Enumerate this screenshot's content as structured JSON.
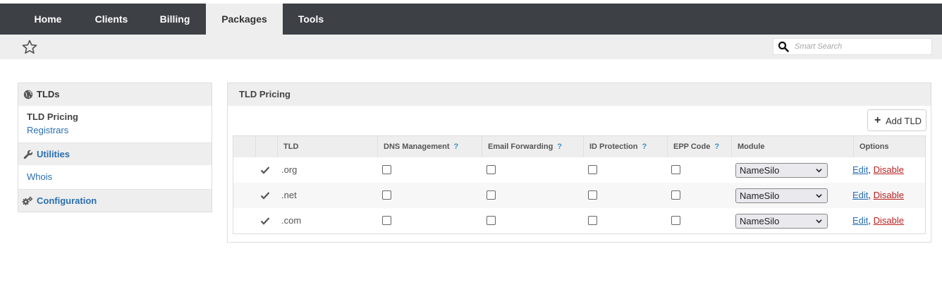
{
  "nav": {
    "tabs": [
      {
        "label": "Home"
      },
      {
        "label": "Clients"
      },
      {
        "label": "Billing"
      },
      {
        "label": "Packages",
        "active": true
      },
      {
        "label": "Tools"
      }
    ]
  },
  "subbar": {
    "star_icon": "star-outline-icon",
    "search": {
      "placeholder": "Smart Search",
      "value": ""
    }
  },
  "sidebar": {
    "sections": [
      {
        "title": "TLDs",
        "icon": "globe-icon",
        "items": [
          {
            "label": "TLD Pricing",
            "current": true
          },
          {
            "label": "Registrars"
          }
        ]
      },
      {
        "title": "Utilities",
        "icon": "wrench-icon",
        "items": [
          {
            "label": "Whois"
          }
        ]
      },
      {
        "title": "Configuration",
        "icon": "gears-icon",
        "items": []
      }
    ]
  },
  "panel": {
    "title": "TLD Pricing",
    "add_button": "Add TLD",
    "columns": [
      "",
      "",
      "TLD",
      "DNS Management",
      "Email Forwarding",
      "ID Protection",
      "EPP Code",
      "Module",
      "Options"
    ],
    "help_mark": "?",
    "rows": [
      {
        "tld": ".org",
        "dns": false,
        "email": false,
        "idp": false,
        "epp": false,
        "module": "NameSilo",
        "edit": "Edit",
        "sep": ",",
        "disable": "Disable"
      },
      {
        "tld": ".net",
        "dns": false,
        "email": false,
        "idp": false,
        "epp": false,
        "module": "NameSilo",
        "edit": "Edit",
        "sep": ",",
        "disable": "Disable"
      },
      {
        "tld": ".com",
        "dns": false,
        "email": false,
        "idp": false,
        "epp": false,
        "module": "NameSilo",
        "edit": "Edit",
        "sep": ",",
        "disable": "Disable"
      }
    ]
  },
  "colors": {
    "nav_bg": "#3d4045",
    "link": "#2a6fb0",
    "danger": "#b22222",
    "help": "#3a8fc9"
  }
}
